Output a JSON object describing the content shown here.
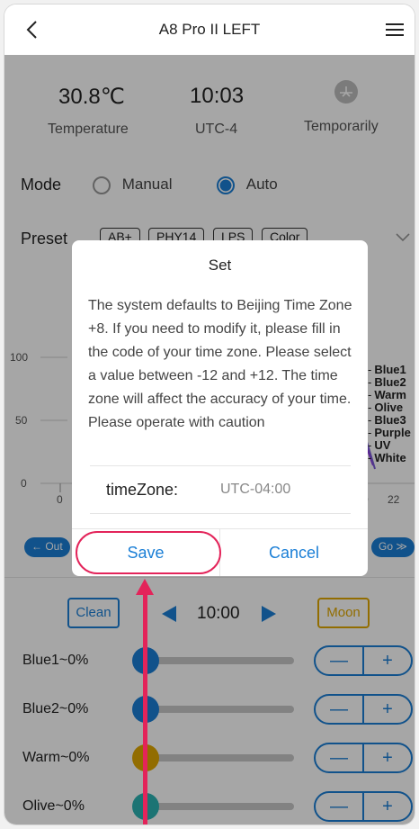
{
  "header": {
    "title": "A8 Pro II LEFT"
  },
  "status": {
    "temperature_value": "30.8℃",
    "temperature_label": "Temperature",
    "time_value": "10:03",
    "time_label": "UTC-4",
    "temporarily_label": "Temporarily"
  },
  "mode": {
    "label": "Mode",
    "manual_label": "Manual",
    "auto_label": "Auto",
    "selected": "Auto"
  },
  "preset": {
    "label": "Preset",
    "chips": [
      "AB+",
      "PHY14",
      "LPS",
      "Color"
    ]
  },
  "chart": {
    "y_ticks": [
      "100",
      "50",
      "0"
    ],
    "x_ticks": [
      "0",
      "0",
      "22"
    ],
    "legend": [
      "Blue1",
      "Blue2",
      "Warm",
      "Olive",
      "Blue3",
      "Purple",
      "UV",
      "White"
    ],
    "legend_colors": [
      "#1b9ad6",
      "#2bb3e6",
      "#e0a800",
      "#2bb3b3",
      "#1b3fd6",
      "#8a2be2",
      "#7b5cd6",
      "#999999"
    ],
    "out_label": "← Out",
    "go_label": "Go ≫"
  },
  "controls": {
    "clean_label": "Clean",
    "moon_label": "Moon",
    "time": "10:00"
  },
  "channels": [
    {
      "label": "Blue1~0%",
      "color": "#1b7fd6"
    },
    {
      "label": "Blue2~0%",
      "color": "#1b7fd6"
    },
    {
      "label": "Warm~0%",
      "color": "#e0a800"
    },
    {
      "label": "Olive~0%",
      "color": "#2bb3b3"
    }
  ],
  "stepper": {
    "minus": "—",
    "plus": "+"
  },
  "dialog": {
    "title": "Set",
    "message": "The system defaults to Beijing Time Zone +8. If you need to modify it, please fill in the code of your time zone. Please select a value between -12 and +12. The time zone will affect the accuracy of your time. Please operate with caution",
    "timezone_label": "timeZone:",
    "timezone_value": "UTC-04:00",
    "save_label": "Save",
    "cancel_label": "Cancel"
  }
}
